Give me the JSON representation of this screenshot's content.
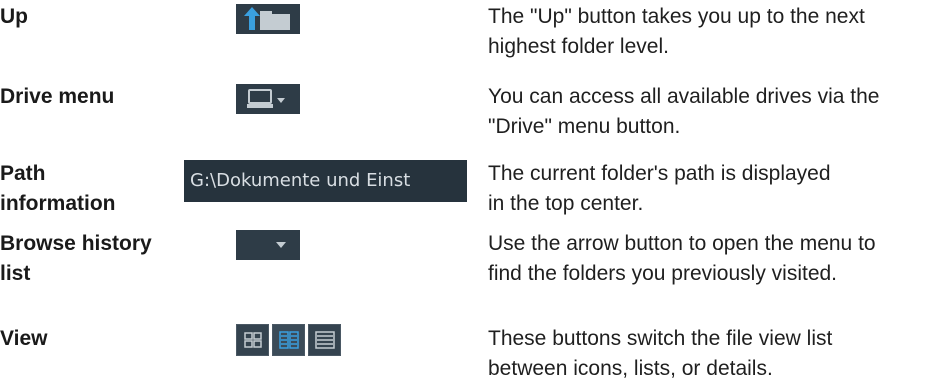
{
  "rows": [
    {
      "term": "Up",
      "icon": "folder-up-icon",
      "desc_1": "The \"Up\" button takes you up to the next",
      "desc_2": "highest folder level."
    },
    {
      "term": "Drive menu",
      "icon": "drive-icon",
      "desc_1": "You can access all available drives via the",
      "desc_2": "\"Drive\" menu button."
    },
    {
      "term_1": "Path",
      "term_2": "information",
      "path_text": "G:\\Dokumente und Einst",
      "desc_1": "The current folder's path is displayed",
      "desc_2": "in the top center."
    },
    {
      "term_1": "Browse history",
      "term_2": "list",
      "icon": "dropdown-arrow-icon",
      "desc_1": "Use the arrow button to open the menu to",
      "desc_2": "find the folders you previously visited."
    },
    {
      "term": "View",
      "icons": [
        "icons-view-icon",
        "list-view-icon",
        "details-view-icon"
      ],
      "desc_1": "These buttons switch the file view list",
      "desc_2": "between icons, lists, or details."
    }
  ],
  "colors": {
    "ui_background": "#2e3c47",
    "accent_blue": "#3aa0e0",
    "icon_gray": "#c4ccd2"
  }
}
